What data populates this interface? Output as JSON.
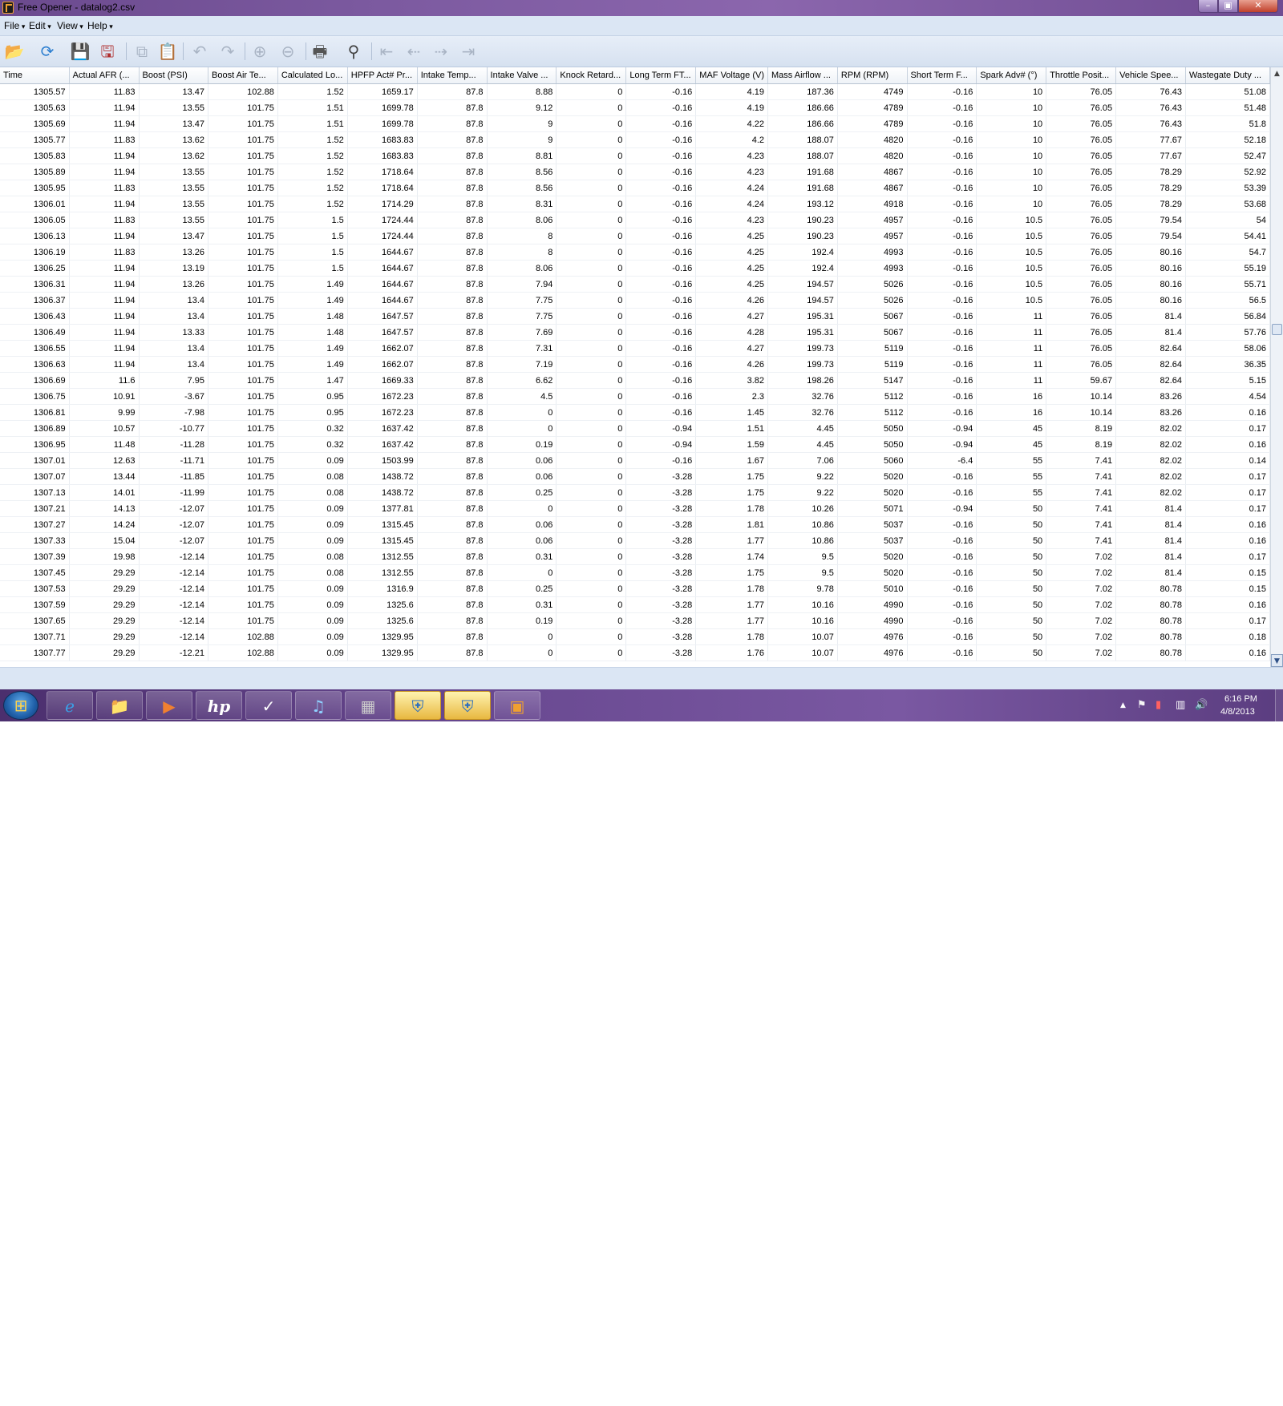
{
  "window": {
    "title": "Free Opener - datalog2.csv"
  },
  "menu": [
    "File",
    "Edit",
    "View",
    "Help"
  ],
  "toolbar_icons": [
    "open-folder-icon",
    "refresh-icon",
    "save-icon",
    "save-as-icon",
    "copy-icon",
    "paste-icon",
    "undo-icon",
    "redo-icon",
    "zoom-in-icon",
    "zoom-out-icon",
    "print-icon",
    "find-icon",
    "first-page-icon",
    "previous-page-icon",
    "next-page-icon",
    "last-page-icon"
  ],
  "table": {
    "columns": [
      "Time",
      "Actual AFR (...",
      "Boost (PSI)",
      "Boost Air Te...",
      "Calculated Lo...",
      "HPFP Act# Pr...",
      "Intake Temp...",
      "Intake Valve ...",
      "Knock Retard...",
      "Long Term FT...",
      "MAF Voltage (V)",
      "Mass Airflow ...",
      "RPM (RPM)",
      "Short Term F...",
      "Spark Adv# (°)",
      "Throttle Posit...",
      "Vehicle Spee...",
      "Wastegate Duty ..."
    ],
    "rows": [
      [
        "1305.57",
        "11.83",
        "13.47",
        "102.88",
        "1.52",
        "1659.17",
        "87.8",
        "8.88",
        "0",
        "-0.16",
        "4.19",
        "187.36",
        "4749",
        "-0.16",
        "10",
        "76.05",
        "76.43",
        "51.08"
      ],
      [
        "1305.63",
        "11.94",
        "13.55",
        "101.75",
        "1.51",
        "1699.78",
        "87.8",
        "9.12",
        "0",
        "-0.16",
        "4.19",
        "186.66",
        "4789",
        "-0.16",
        "10",
        "76.05",
        "76.43",
        "51.48"
      ],
      [
        "1305.69",
        "11.94",
        "13.47",
        "101.75",
        "1.51",
        "1699.78",
        "87.8",
        "9",
        "0",
        "-0.16",
        "4.22",
        "186.66",
        "4789",
        "-0.16",
        "10",
        "76.05",
        "76.43",
        "51.8"
      ],
      [
        "1305.77",
        "11.83",
        "13.62",
        "101.75",
        "1.52",
        "1683.83",
        "87.8",
        "9",
        "0",
        "-0.16",
        "4.2",
        "188.07",
        "4820",
        "-0.16",
        "10",
        "76.05",
        "77.67",
        "52.18"
      ],
      [
        "1305.83",
        "11.94",
        "13.62",
        "101.75",
        "1.52",
        "1683.83",
        "87.8",
        "8.81",
        "0",
        "-0.16",
        "4.23",
        "188.07",
        "4820",
        "-0.16",
        "10",
        "76.05",
        "77.67",
        "52.47"
      ],
      [
        "1305.89",
        "11.94",
        "13.55",
        "101.75",
        "1.52",
        "1718.64",
        "87.8",
        "8.56",
        "0",
        "-0.16",
        "4.23",
        "191.68",
        "4867",
        "-0.16",
        "10",
        "76.05",
        "78.29",
        "52.92"
      ],
      [
        "1305.95",
        "11.83",
        "13.55",
        "101.75",
        "1.52",
        "1718.64",
        "87.8",
        "8.56",
        "0",
        "-0.16",
        "4.24",
        "191.68",
        "4867",
        "-0.16",
        "10",
        "76.05",
        "78.29",
        "53.39"
      ],
      [
        "1306.01",
        "11.94",
        "13.55",
        "101.75",
        "1.52",
        "1714.29",
        "87.8",
        "8.31",
        "0",
        "-0.16",
        "4.24",
        "193.12",
        "4918",
        "-0.16",
        "10",
        "76.05",
        "78.29",
        "53.68"
      ],
      [
        "1306.05",
        "11.83",
        "13.55",
        "101.75",
        "1.5",
        "1724.44",
        "87.8",
        "8.06",
        "0",
        "-0.16",
        "4.23",
        "190.23",
        "4957",
        "-0.16",
        "10.5",
        "76.05",
        "79.54",
        "54"
      ],
      [
        "1306.13",
        "11.94",
        "13.47",
        "101.75",
        "1.5",
        "1724.44",
        "87.8",
        "8",
        "0",
        "-0.16",
        "4.25",
        "190.23",
        "4957",
        "-0.16",
        "10.5",
        "76.05",
        "79.54",
        "54.41"
      ],
      [
        "1306.19",
        "11.83",
        "13.26",
        "101.75",
        "1.5",
        "1644.67",
        "87.8",
        "8",
        "0",
        "-0.16",
        "4.25",
        "192.4",
        "4993",
        "-0.16",
        "10.5",
        "76.05",
        "80.16",
        "54.7"
      ],
      [
        "1306.25",
        "11.94",
        "13.19",
        "101.75",
        "1.5",
        "1644.67",
        "87.8",
        "8.06",
        "0",
        "-0.16",
        "4.25",
        "192.4",
        "4993",
        "-0.16",
        "10.5",
        "76.05",
        "80.16",
        "55.19"
      ],
      [
        "1306.31",
        "11.94",
        "13.26",
        "101.75",
        "1.49",
        "1644.67",
        "87.8",
        "7.94",
        "0",
        "-0.16",
        "4.25",
        "194.57",
        "5026",
        "-0.16",
        "10.5",
        "76.05",
        "80.16",
        "55.71"
      ],
      [
        "1306.37",
        "11.94",
        "13.4",
        "101.75",
        "1.49",
        "1644.67",
        "87.8",
        "7.75",
        "0",
        "-0.16",
        "4.26",
        "194.57",
        "5026",
        "-0.16",
        "10.5",
        "76.05",
        "80.16",
        "56.5"
      ],
      [
        "1306.43",
        "11.94",
        "13.4",
        "101.75",
        "1.48",
        "1647.57",
        "87.8",
        "7.75",
        "0",
        "-0.16",
        "4.27",
        "195.31",
        "5067",
        "-0.16",
        "11",
        "76.05",
        "81.4",
        "56.84"
      ],
      [
        "1306.49",
        "11.94",
        "13.33",
        "101.75",
        "1.48",
        "1647.57",
        "87.8",
        "7.69",
        "0",
        "-0.16",
        "4.28",
        "195.31",
        "5067",
        "-0.16",
        "11",
        "76.05",
        "81.4",
        "57.76"
      ],
      [
        "1306.55",
        "11.94",
        "13.4",
        "101.75",
        "1.49",
        "1662.07",
        "87.8",
        "7.31",
        "0",
        "-0.16",
        "4.27",
        "199.73",
        "5119",
        "-0.16",
        "11",
        "76.05",
        "82.64",
        "58.06"
      ],
      [
        "1306.63",
        "11.94",
        "13.4",
        "101.75",
        "1.49",
        "1662.07",
        "87.8",
        "7.19",
        "0",
        "-0.16",
        "4.26",
        "199.73",
        "5119",
        "-0.16",
        "11",
        "76.05",
        "82.64",
        "36.35"
      ],
      [
        "1306.69",
        "11.6",
        "7.95",
        "101.75",
        "1.47",
        "1669.33",
        "87.8",
        "6.62",
        "0",
        "-0.16",
        "3.82",
        "198.26",
        "5147",
        "-0.16",
        "11",
        "59.67",
        "82.64",
        "5.15"
      ],
      [
        "1306.75",
        "10.91",
        "-3.67",
        "101.75",
        "0.95",
        "1672.23",
        "87.8",
        "4.5",
        "0",
        "-0.16",
        "2.3",
        "32.76",
        "5112",
        "-0.16",
        "16",
        "10.14",
        "83.26",
        "4.54"
      ],
      [
        "1306.81",
        "9.99",
        "-7.98",
        "101.75",
        "0.95",
        "1672.23",
        "87.8",
        "0",
        "0",
        "-0.16",
        "1.45",
        "32.76",
        "5112",
        "-0.16",
        "16",
        "10.14",
        "83.26",
        "0.16"
      ],
      [
        "1306.89",
        "10.57",
        "-10.77",
        "101.75",
        "0.32",
        "1637.42",
        "87.8",
        "0",
        "0",
        "-0.94",
        "1.51",
        "4.45",
        "5050",
        "-0.94",
        "45",
        "8.19",
        "82.02",
        "0.17"
      ],
      [
        "1306.95",
        "11.48",
        "-11.28",
        "101.75",
        "0.32",
        "1637.42",
        "87.8",
        "0.19",
        "0",
        "-0.94",
        "1.59",
        "4.45",
        "5050",
        "-0.94",
        "45",
        "8.19",
        "82.02",
        "0.16"
      ],
      [
        "1307.01",
        "12.63",
        "-11.71",
        "101.75",
        "0.09",
        "1503.99",
        "87.8",
        "0.06",
        "0",
        "-0.16",
        "1.67",
        "7.06",
        "5060",
        "-6.4",
        "55",
        "7.41",
        "82.02",
        "0.14"
      ],
      [
        "1307.07",
        "13.44",
        "-11.85",
        "101.75",
        "0.08",
        "1438.72",
        "87.8",
        "0.06",
        "0",
        "-3.28",
        "1.75",
        "9.22",
        "5020",
        "-0.16",
        "55",
        "7.41",
        "82.02",
        "0.17"
      ],
      [
        "1307.13",
        "14.01",
        "-11.99",
        "101.75",
        "0.08",
        "1438.72",
        "87.8",
        "0.25",
        "0",
        "-3.28",
        "1.75",
        "9.22",
        "5020",
        "-0.16",
        "55",
        "7.41",
        "82.02",
        "0.17"
      ],
      [
        "1307.21",
        "14.13",
        "-12.07",
        "101.75",
        "0.09",
        "1377.81",
        "87.8",
        "0",
        "0",
        "-3.28",
        "1.78",
        "10.26",
        "5071",
        "-0.94",
        "50",
        "7.41",
        "81.4",
        "0.17"
      ],
      [
        "1307.27",
        "14.24",
        "-12.07",
        "101.75",
        "0.09",
        "1315.45",
        "87.8",
        "0.06",
        "0",
        "-3.28",
        "1.81",
        "10.86",
        "5037",
        "-0.16",
        "50",
        "7.41",
        "81.4",
        "0.16"
      ],
      [
        "1307.33",
        "15.04",
        "-12.07",
        "101.75",
        "0.09",
        "1315.45",
        "87.8",
        "0.06",
        "0",
        "-3.28",
        "1.77",
        "10.86",
        "5037",
        "-0.16",
        "50",
        "7.41",
        "81.4",
        "0.16"
      ],
      [
        "1307.39",
        "19.98",
        "-12.14",
        "101.75",
        "0.08",
        "1312.55",
        "87.8",
        "0.31",
        "0",
        "-3.28",
        "1.74",
        "9.5",
        "5020",
        "-0.16",
        "50",
        "7.02",
        "81.4",
        "0.17"
      ],
      [
        "1307.45",
        "29.29",
        "-12.14",
        "101.75",
        "0.08",
        "1312.55",
        "87.8",
        "0",
        "0",
        "-3.28",
        "1.75",
        "9.5",
        "5020",
        "-0.16",
        "50",
        "7.02",
        "81.4",
        "0.15"
      ],
      [
        "1307.53",
        "29.29",
        "-12.14",
        "101.75",
        "0.09",
        "1316.9",
        "87.8",
        "0.25",
        "0",
        "-3.28",
        "1.78",
        "9.78",
        "5010",
        "-0.16",
        "50",
        "7.02",
        "80.78",
        "0.15"
      ],
      [
        "1307.59",
        "29.29",
        "-12.14",
        "101.75",
        "0.09",
        "1325.6",
        "87.8",
        "0.31",
        "0",
        "-3.28",
        "1.77",
        "10.16",
        "4990",
        "-0.16",
        "50",
        "7.02",
        "80.78",
        "0.16"
      ],
      [
        "1307.65",
        "29.29",
        "-12.14",
        "101.75",
        "0.09",
        "1325.6",
        "87.8",
        "0.19",
        "0",
        "-3.28",
        "1.77",
        "10.16",
        "4990",
        "-0.16",
        "50",
        "7.02",
        "80.78",
        "0.17"
      ],
      [
        "1307.71",
        "29.29",
        "-12.14",
        "102.88",
        "0.09",
        "1329.95",
        "87.8",
        "0",
        "0",
        "-3.28",
        "1.78",
        "10.07",
        "4976",
        "-0.16",
        "50",
        "7.02",
        "80.78",
        "0.18"
      ],
      [
        "1307.77",
        "29.29",
        "-12.21",
        "102.88",
        "0.09",
        "1329.95",
        "87.8",
        "0",
        "0",
        "-3.28",
        "1.76",
        "10.07",
        "4976",
        "-0.16",
        "50",
        "7.02",
        "80.78",
        "0.16"
      ]
    ]
  },
  "taskbar": {
    "buttons": [
      "internet-explorer-icon",
      "file-explorer-icon",
      "media-player-icon",
      "hp-icon",
      "app-check-icon",
      "itunes-icon",
      "device-icon",
      "security-shield-icon",
      "security-shield-icon",
      "free-opener-icon"
    ],
    "clock_time": "6:16 PM",
    "clock_date": "4/8/2013"
  }
}
